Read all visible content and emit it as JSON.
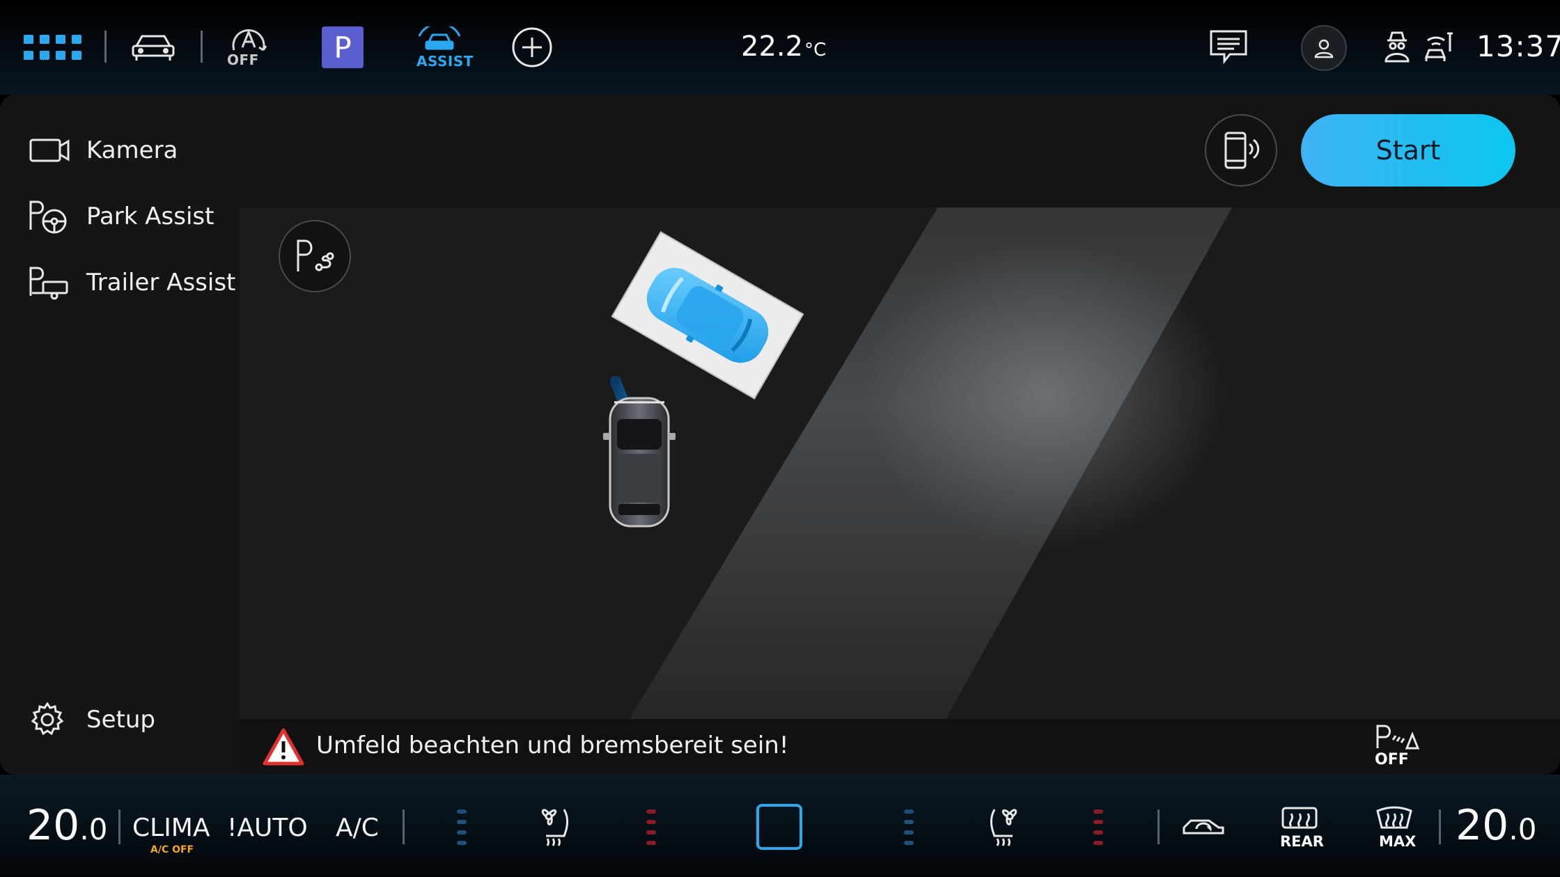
{
  "status_bar": {
    "auto_hold_label": "OFF",
    "parking_label": "P",
    "assist_label": "ASSIST",
    "outside_temp_value": "22.2",
    "outside_temp_unit": "°C",
    "clock": "13:37"
  },
  "sidebar": {
    "items": [
      {
        "label": "Kamera",
        "icon": "camera-icon"
      },
      {
        "label": "Park Assist",
        "icon": "park-assist-icon"
      },
      {
        "label": "Trailer Assist",
        "icon": "trailer-assist-icon"
      }
    ],
    "setup_label": "Setup"
  },
  "park_view": {
    "start_label": "Start",
    "warning_text": "Umfeld beachten und bremsbereit sein!",
    "park_off_label": "OFF"
  },
  "climate": {
    "left_temp_int": "20",
    "left_temp_dec": ".0",
    "clima_label": "CLIMA",
    "ac_off_label": "A/C OFF",
    "auto_label": "!AUTO",
    "ac_label": "A/C",
    "rear_label": "REAR",
    "max_label": "MAX",
    "right_temp_int": "20",
    "right_temp_dec": ".0"
  },
  "colors": {
    "accent": "#1ea8f0",
    "start_button": "#20bdf2",
    "warning_red": "#e03030",
    "heat_red": "#8a1c2a",
    "ac_off_orange": "#f5a623"
  }
}
